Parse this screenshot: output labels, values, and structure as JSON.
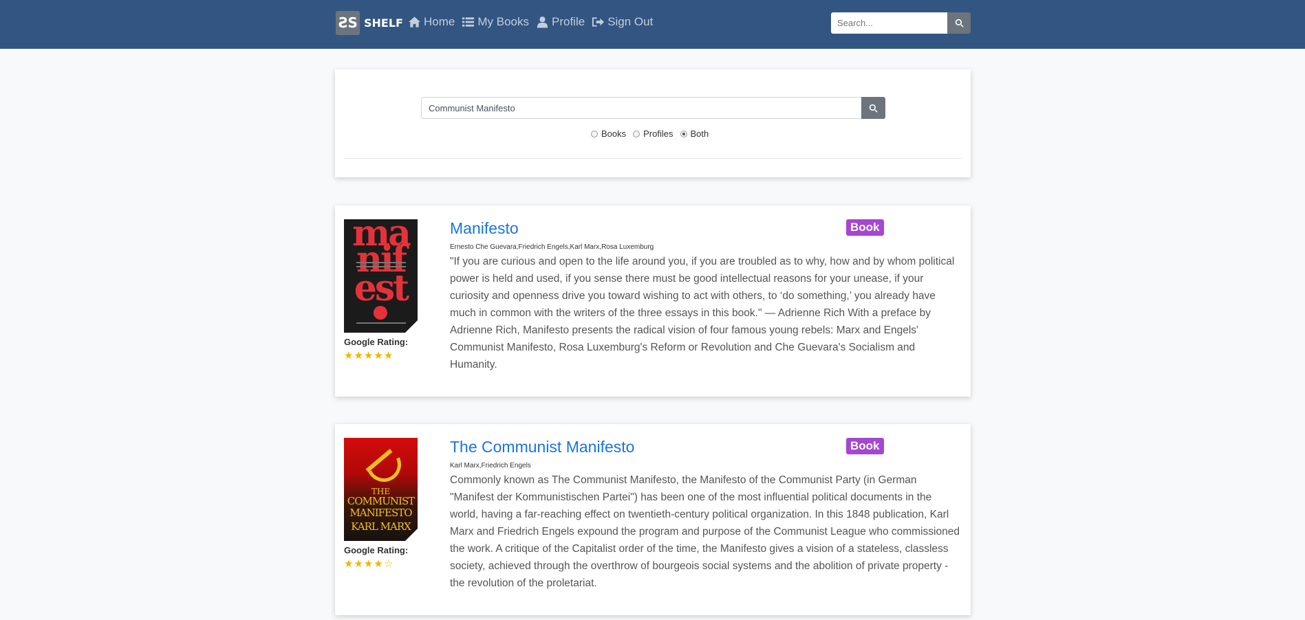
{
  "nav": {
    "brand_logo": "ƧS",
    "brand_name": "SHELF",
    "links": [
      {
        "label": "Home",
        "icon": "home-icon"
      },
      {
        "label": "My Books",
        "icon": "list-icon"
      },
      {
        "label": "Profile",
        "icon": "user-icon"
      },
      {
        "label": "Sign Out",
        "icon": "sign-out-icon"
      }
    ],
    "search_placeholder": "Search..."
  },
  "search": {
    "query": "Communist Manifesto",
    "options": [
      {
        "label": "Books",
        "checked": false
      },
      {
        "label": "Profiles",
        "checked": false
      },
      {
        "label": "Both",
        "checked": true
      }
    ]
  },
  "results": [
    {
      "title": "Manifesto",
      "badge": "Book",
      "authors": "Ernesto Che Guevara,Friedrich Engels,Karl Marx,Rosa Luxemburg",
      "description": "\"If you are curious and open to the life around you, if you are troubled as to why, how and by whom political power is held and used, if you sense there must be good intellectual reasons for your unease, if your curiosity and openness drive you toward wishing to act with others, to ‘do something,’ you already have much in common with the writers of the three essays in this book.\" — Adrienne Rich With a preface by Adrienne Rich, Manifesto presents the radical vision of four famous young rebels: Marx and Engels' Communist Manifesto, Rosa Luxemburg's Reform or Revolution and Che Guevara's Socialism and Humanity.",
      "rating_label": "Google Rating:",
      "rating": 5,
      "rating_max": 5,
      "cover_text": [
        "ma",
        "nif",
        "est"
      ]
    },
    {
      "title": "The Communist Manifesto",
      "badge": "Book",
      "authors": "Karl Marx,Friedrich Engels",
      "description": "Commonly known as The Communist Manifesto, the Manifesto of the Communist Party (in German \"Manifest der Kommunistischen Partei\") has been one of the most influential political documents in the world, having a far-reaching effect on twentieth-century political organization. In this 1848 publication, Karl Marx and Friedrich Engels expound the program and purpose of the Communist League who commissioned the work. A critique of the Capitalist order of the time, the Manifesto gives a vision of a stateless, classless society, achieved through the overthrow of bourgeois social systems and the abolition of private property - the revolution of the proletariat.",
      "rating_label": "Google Rating:",
      "rating": 4,
      "rating_max": 5,
      "cover_text": [
        "THE",
        "COMMUNIST",
        "MANIFESTO",
        "KARL MARX"
      ]
    }
  ],
  "colors": {
    "navbar": "#335582",
    "link": "#1a73e8",
    "badge": "#a646d1",
    "star": "#f0b400"
  }
}
